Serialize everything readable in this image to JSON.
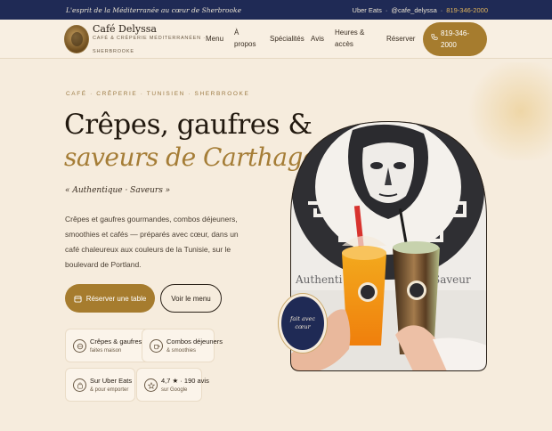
{
  "topbar": {
    "tagline": "L'esprit de la Méditerranée au cœur de Sherbrooke",
    "ubereats": "Uber Eats",
    "sep1": "·",
    "instagram": "@cafe_delyssa",
    "sep2": "·",
    "phone": "819-346-2000"
  },
  "brand": {
    "name": "Café Delyssa",
    "subtitle_line1": "CAFÉ & CRÊPERIE MÉDITERRANÉEN ·",
    "subtitle_line2": "SHERBROOKE"
  },
  "nav": {
    "menu": "Menu",
    "apropos_1": "À",
    "apropos_2": "propos",
    "specialites": "Spécialités",
    "avis": "Avis",
    "heures_1": "Heures &",
    "heures_2": "accès",
    "reserver": "Réserver",
    "call_1": "819-346-",
    "call_2": "2000"
  },
  "hero": {
    "eyebrow": "CAFÉ · CRÊPERIE · TUNISIEN · SHERBROOKE",
    "title_line1": "Crêpes, gaufres &",
    "title_line2": "saveurs de Carthage",
    "title_dot": ".",
    "quote": "« Authentique · Saveurs »",
    "description": "Crêpes et gaufres gourmandes, combos déjeuners, smoothies et cafés — préparés avec cœur, dans un café chaleureux aux couleurs de la Tunisie, sur le boulevard de Portland.",
    "btn_reserve": "Réserver une table",
    "btn_menu": "Voir le menu",
    "badge": "fait avec cœur"
  },
  "features": [
    {
      "title": "Crêpes & gaufres",
      "sub": "faites maison",
      "icon": "crepe-icon"
    },
    {
      "title": "Combos déjeuners",
      "sub": "& smoothies",
      "icon": "coffee-icon"
    },
    {
      "title": "Sur Uber Eats",
      "sub": "& pour emporter",
      "icon": "bag-icon"
    },
    {
      "title": "4,7 ★ · 190 avis",
      "sub": "sur Google",
      "icon": "star-icon"
    }
  ],
  "colors": {
    "navy": "#1f2a55",
    "gold": "#a67c2e",
    "cream": "#f6ecdd",
    "accent_phone": "#e0b35a"
  }
}
